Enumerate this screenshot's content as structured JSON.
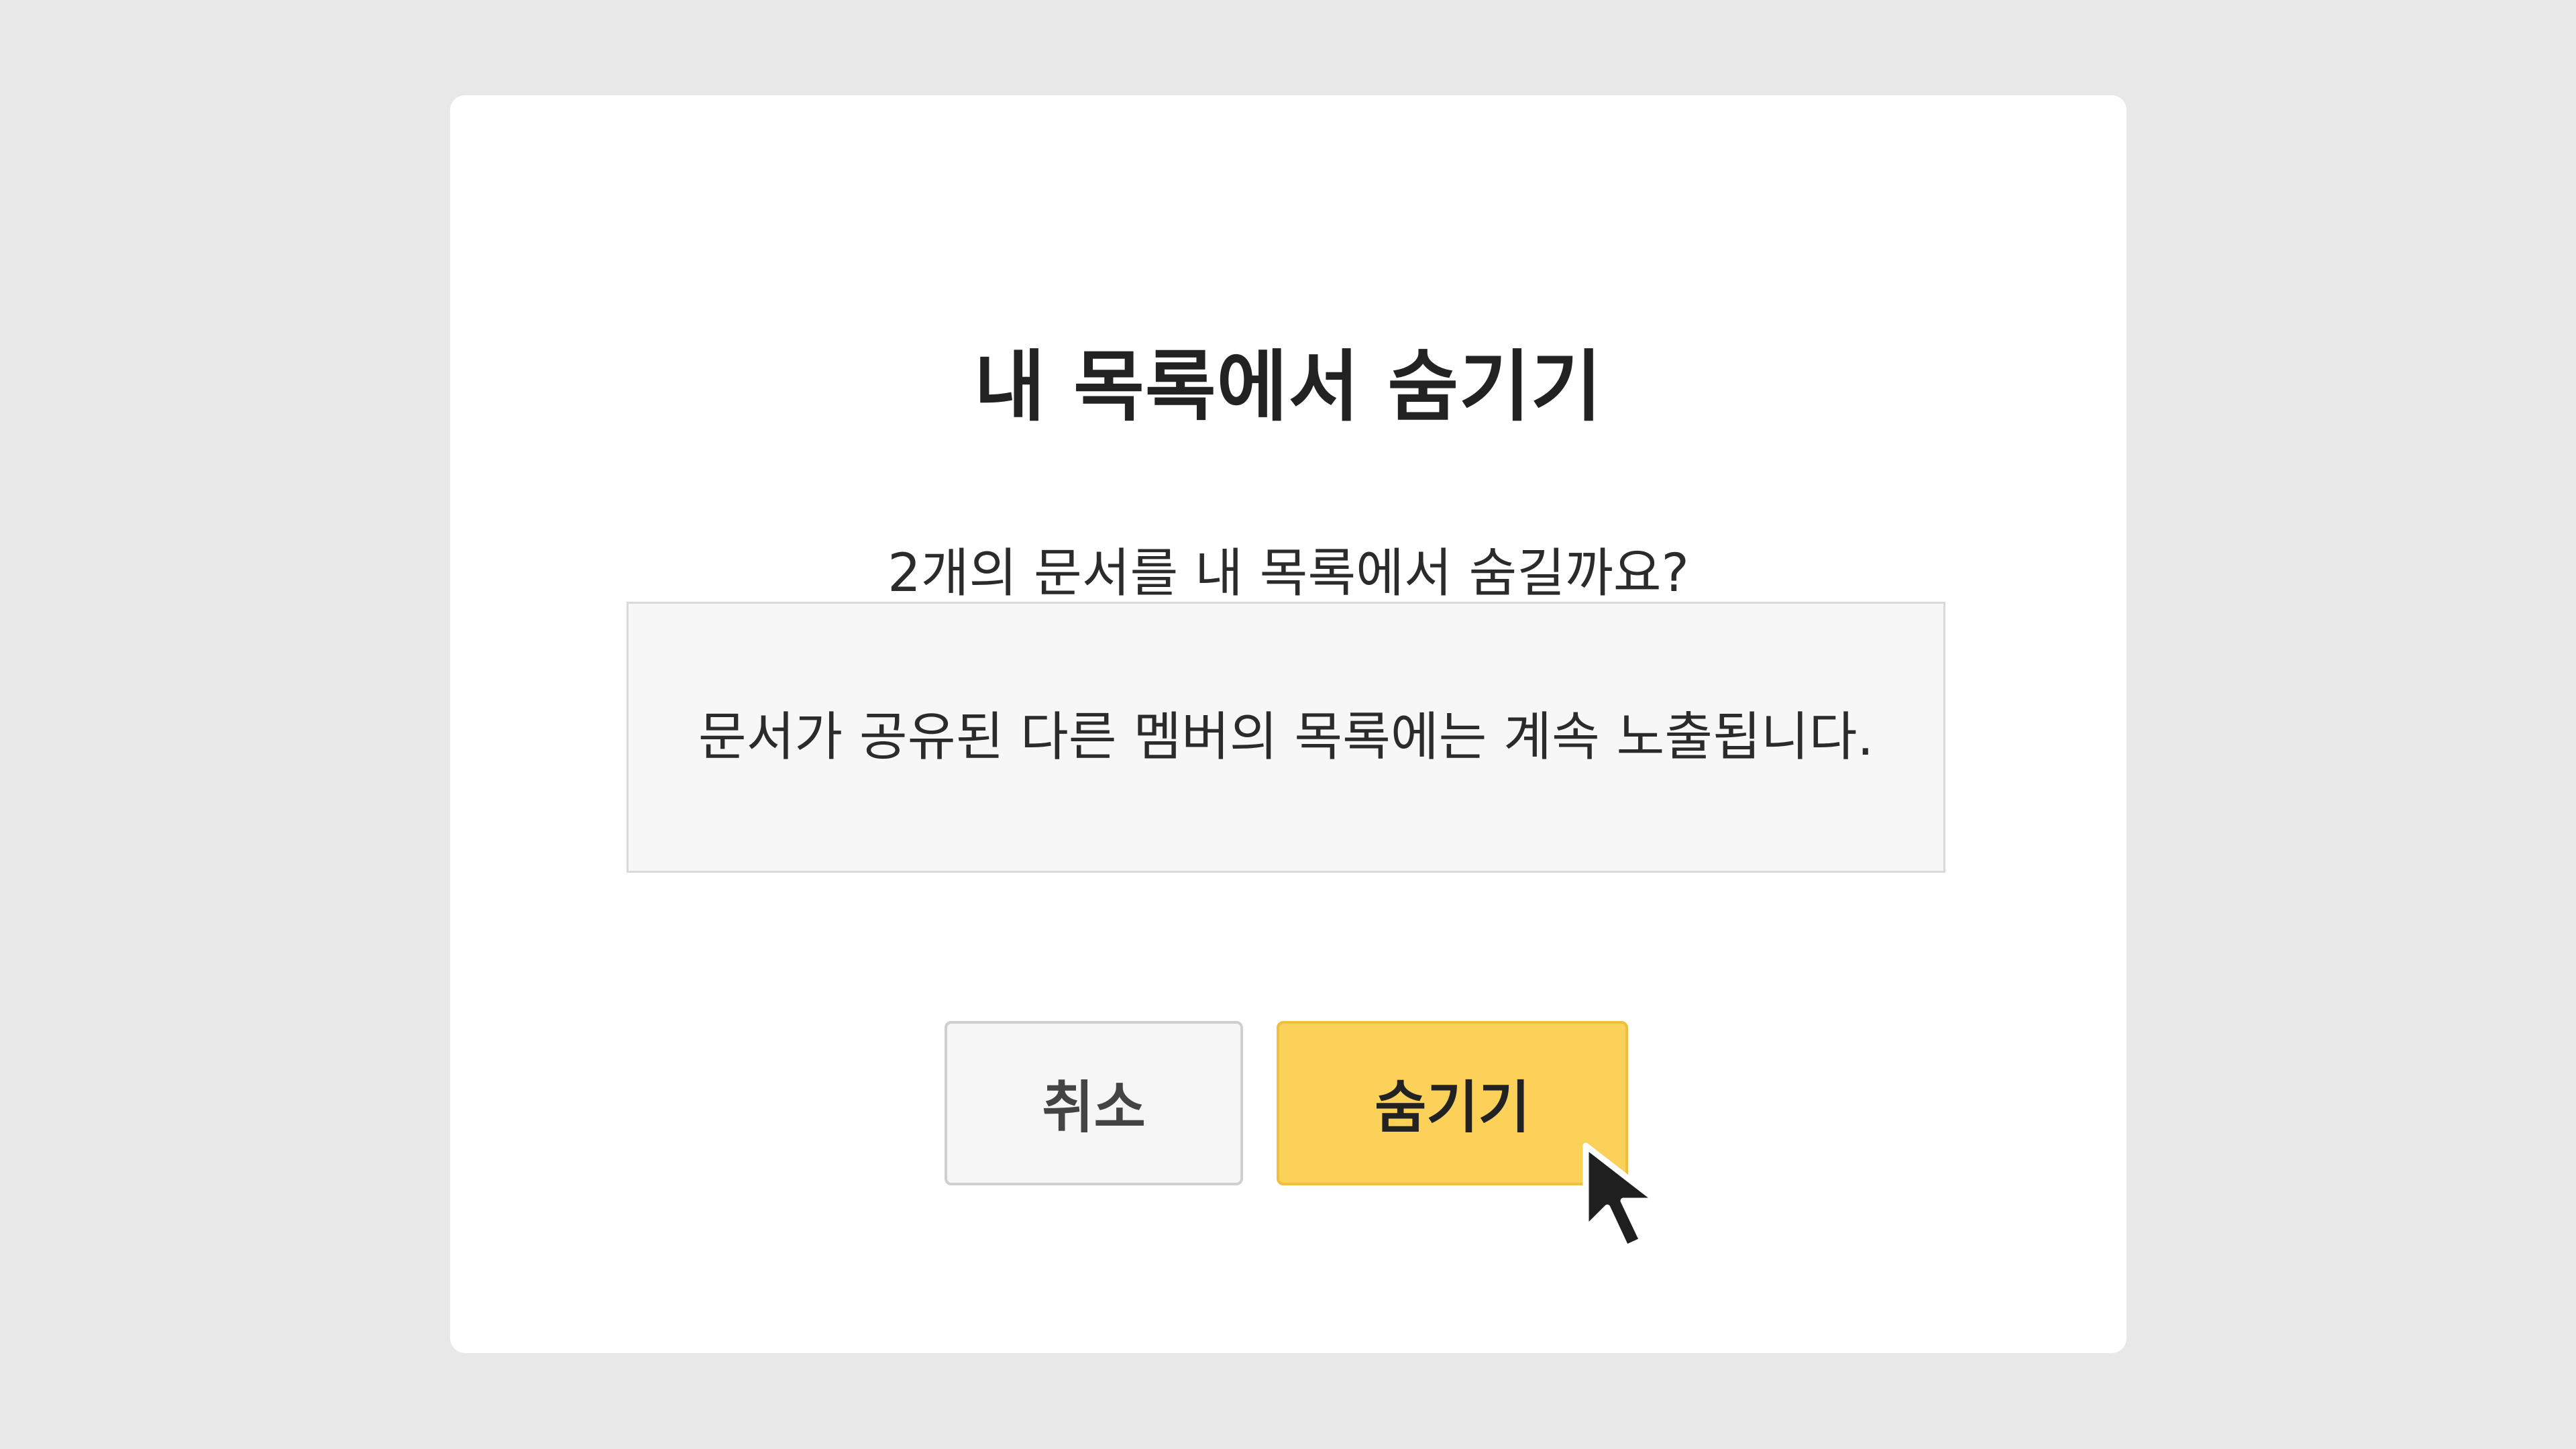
{
  "dialog": {
    "title": "내 목록에서 숨기기",
    "message": "2개의 문서를 내 목록에서 숨길까요?",
    "notice": "문서가 공유된 다른 멤버의 목록에는 계속 노출됩니다.",
    "buttons": {
      "cancel_label": "취소",
      "hide_label": "숨기기"
    }
  },
  "colors": {
    "background": "#e8e8e8",
    "dialog": "#ffffff",
    "notice_background": "#f7f7f7",
    "primary_button": "#fcd15a",
    "secondary_button": "#f6f6f6"
  },
  "cursor": {
    "icon": "arrow-pointer-icon"
  }
}
